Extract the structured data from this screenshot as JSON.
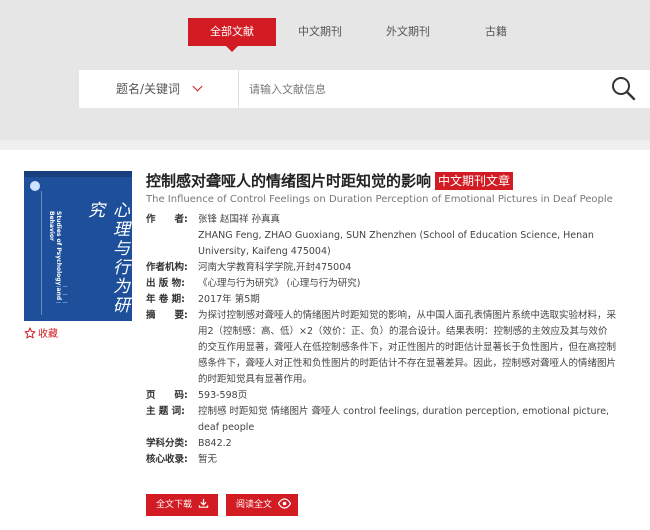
{
  "tabs": [
    {
      "label": "全部文献"
    },
    {
      "label": "中文期刊"
    },
    {
      "label": "外文期刊"
    },
    {
      "label": "古籍"
    }
  ],
  "search": {
    "field": "题名/关键词",
    "placeholder": "请输入文献信息"
  },
  "article": {
    "title": "控制感对聋哑人的情绪图片时距知觉的影响",
    "badge": "中文期刊文章",
    "title_en": "The Influence of Control Feelings on Duration Perception of Emotional Pictures in Deaf People",
    "favorite": "收藏",
    "cover": {
      "title": "心理与行为研究",
      "title_en": "Studies of Psychology and Behavior"
    },
    "fields": [
      {
        "label": "作　　者:",
        "value": "张锋  赵国祥  孙真真"
      },
      {
        "label": "",
        "value": "ZHANG Feng, ZHAO Guoxiang, SUN Zhenzhen  (School of Education Science, Henan University, Kaifeng 475004)"
      },
      {
        "label": "作者机构:",
        "value": "河南大学教育科学学院,开封475004"
      },
      {
        "label": "出 版 物:",
        "value": "《心理与行为研究》 (心理与行为研究)"
      },
      {
        "label": "年 卷 期:",
        "value": "2017年 第5期"
      },
      {
        "label": "摘　　要:",
        "value": "为探讨控制感对聋哑人的情绪图片时距知觉的影响，从中国人面孔表情图片系统中选取实验材料，采用2（控制感：高、低）×2（效价：正、负）的混合设计。结果表明：控制感的主效应及其与效价的交互作用显著，聋哑人在低控制感条件下，对正性图片的时距估计显著长于负性图片，但在高控制感条件下，聋哑人对正性和负性图片的时距估计不存在显著差异。因此，控制感对聋哑人的情绪图片的时距知觉具有显著作用。"
      },
      {
        "label": "页　　码:",
        "value": "593-598页"
      },
      {
        "label": "主 题 词:",
        "value": "控制感 时距知觉 情绪图片 聋哑人  control feelings, duration perception, emotional picture, deaf people"
      },
      {
        "label": "学科分类:",
        "value": "B842.2"
      },
      {
        "label": "核心收录:",
        "value": "暂无"
      }
    ],
    "actions": {
      "download": "全文下载",
      "read": "阅读全文"
    }
  },
  "colors": {
    "accent": "#d31b23",
    "cover": "#1d4f9a"
  }
}
